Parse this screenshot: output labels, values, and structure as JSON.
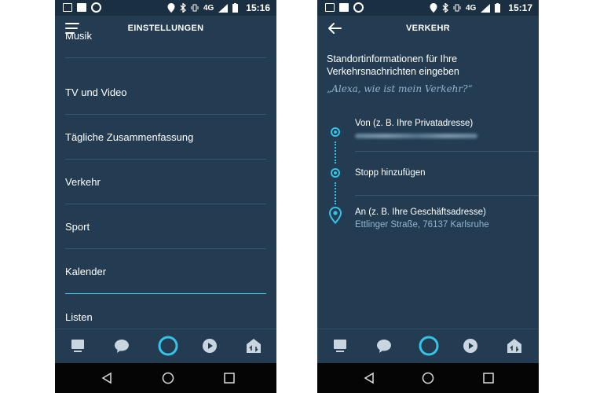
{
  "left_screen": {
    "status": {
      "time": "15:16",
      "network": "4G"
    },
    "header": {
      "title": "EINSTELLUNGEN"
    },
    "settings_items": [
      {
        "label": "Musik"
      },
      {
        "label": "TV und Video"
      },
      {
        "label": "Tägliche Zusammenfassung"
      },
      {
        "label": "Verkehr"
      },
      {
        "label": "Sport"
      },
      {
        "label": "Kalender"
      },
      {
        "label": "Listen"
      }
    ]
  },
  "right_screen": {
    "status": {
      "time": "15:17",
      "network": "4G"
    },
    "header": {
      "title": "VERKEHR"
    },
    "prompt": "Standortinformationen für Ihre Verkehrsnachrichten eingeben",
    "example_query": "„Alexa, wie ist mein Verkehr?“",
    "route": {
      "from_label": "Von (z. B. Ihre Privatadresse)",
      "stop_label": "Stopp hinzufügen",
      "to_label": "An (z. B. Ihre Geschäftsadresse)",
      "to_value": "Ettlinger Straße, 76137 Karlsruhe"
    }
  },
  "bottom_nav": [
    "home-icon",
    "chat-icon",
    "alexa-icon",
    "play-icon",
    "devices-icon"
  ],
  "android_nav": [
    "back-icon",
    "home-circle-icon",
    "recents-icon"
  ],
  "colors": {
    "background": "#233c52",
    "accent": "#35c4e8",
    "divider": "#3a5770",
    "muted_text": "#8fb4cf",
    "icon": "#c9d6e0"
  }
}
